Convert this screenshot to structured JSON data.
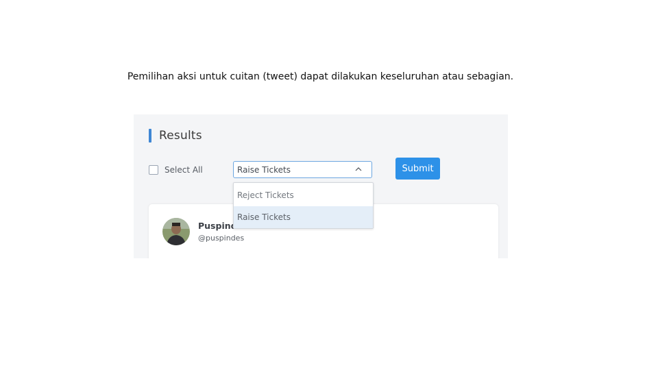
{
  "caption": "Pemilihan aksi untuk cuitan (tweet) dapat dilakukan keseluruhan atau sebagian.",
  "results": {
    "title": "Results",
    "accent_color": "#3f87d4"
  },
  "toolbar": {
    "select_all_label": "Select All",
    "select_all_checked": false,
    "action_dropdown": {
      "selected": "Raise Tickets",
      "expanded": true,
      "options": [
        "Reject Tickets",
        "Raise Tickets"
      ],
      "highlighted_option": "Raise Tickets"
    },
    "submit_label": "Submit",
    "submit_color": "#2d91e8"
  },
  "tweet_card": {
    "user_name": "Puspindes",
    "user_handle": "@puspindes"
  },
  "icons": {
    "chevron": "chevron-up-icon",
    "avatar": "avatar"
  }
}
